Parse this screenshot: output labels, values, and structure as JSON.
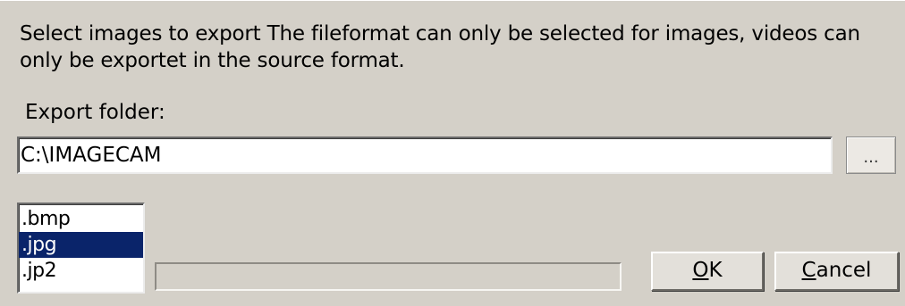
{
  "dialog": {
    "instructions": "Select images to export The fileformat can only be selected for images, videos can only be exportet in the source format."
  },
  "export_folder": {
    "label": "Export folder:",
    "value": "C:\\IMAGECAM",
    "browse_label": "..."
  },
  "formats": {
    "items": [
      {
        "label": ".bmp",
        "selected": false
      },
      {
        "label": ".jpg",
        "selected": true
      },
      {
        "label": ".jp2",
        "selected": false
      }
    ],
    "selected_color": "#0a246a"
  },
  "progress": {
    "value_percent": 0
  },
  "buttons": {
    "ok": {
      "accel": "O",
      "rest": "K"
    },
    "cancel": {
      "accel": "C",
      "rest": "ancel"
    }
  }
}
